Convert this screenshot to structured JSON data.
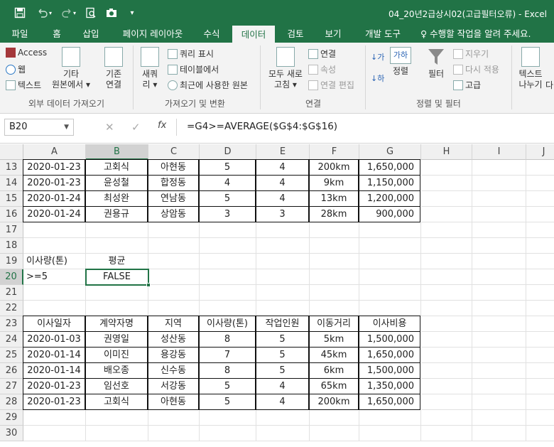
{
  "window": {
    "title": "04_20년2급상시02(고급필터오류) - Excel"
  },
  "quick_access": {
    "save_icon": "save-icon",
    "undo_icon": "undo-icon",
    "redo_icon": "redo-icon",
    "print_preview_icon": "print-preview-icon",
    "camera_icon": "camera-icon",
    "customize_label": "▾"
  },
  "ribbon_tabs": [
    "파일",
    "홈",
    "삽입",
    "페이지 레이아웃",
    "수식",
    "데이터",
    "검토",
    "보기",
    "개발 도구"
  ],
  "active_tab": "데이터",
  "tell_me": "♀ 수행할 작업을 알려 주세요.",
  "ribbon": {
    "get_external": {
      "access": "Access",
      "web": "웹",
      "text": "텍스트",
      "other_line1": "기타",
      "other_line2": "원본에서 ▾",
      "existing_line1": "기존",
      "existing_line2": "연결",
      "group_label": "외부 데이터 가져오기"
    },
    "get_transform": {
      "new_query_line1": "새쿼",
      "new_query_line2": "리 ▾",
      "show_queries": "쿼리 표시",
      "from_table": "테이블에서",
      "recent_sources": "최근에 사용한 원본",
      "group_label": "가져오기 및 변환"
    },
    "connections": {
      "refresh_line1": "모두 새로",
      "refresh_line2": "고침 ▾",
      "connections": "연결",
      "properties": "속성",
      "edit_links": "연결 편집",
      "group_label": "연결"
    },
    "sort_filter": {
      "sort_az": "↓가",
      "sort_za": "↓하",
      "sort_box": "가하",
      "sort": "정렬",
      "filter": "필터",
      "clear": "지우기",
      "reapply": "다시 적용",
      "advanced": "고급",
      "group_label": "정렬 및 필터"
    },
    "data_tools": {
      "text_to_columns_line1": "텍스트",
      "text_to_columns_line2": "나누기",
      "more": "다"
    }
  },
  "formula_bar": {
    "name_box": "B20",
    "cancel": "✕",
    "enter": "✓",
    "fx": "fx",
    "formula": "=G4>=AVERAGE($G$4:$G$16)"
  },
  "sheet": {
    "columns": [
      "A",
      "B",
      "C",
      "D",
      "E",
      "F",
      "G",
      "H",
      "I",
      "J"
    ],
    "selected_cell": "B20",
    "rows": [
      {
        "num": "13",
        "cells": [
          "2020-01-23",
          "고회식",
          "아현동",
          "5",
          "4",
          "200km",
          "1,650,000"
        ]
      },
      {
        "num": "14",
        "cells": [
          "2020-01-23",
          "윤성철",
          "합정동",
          "4",
          "4",
          "9km",
          "1,150,000"
        ]
      },
      {
        "num": "15",
        "cells": [
          "2020-01-24",
          "최성완",
          "연남동",
          "5",
          "4",
          "13km",
          "1,200,000"
        ]
      },
      {
        "num": "16",
        "cells": [
          "2020-01-24",
          "권용규",
          "상암동",
          "3",
          "3",
          "28km",
          "900,000"
        ]
      },
      {
        "num": "17",
        "cells": [
          "",
          "",
          "",
          "",
          "",
          "",
          ""
        ]
      },
      {
        "num": "18",
        "cells": [
          "",
          "",
          "",
          "",
          "",
          "",
          ""
        ]
      },
      {
        "num": "19",
        "cells": [
          "이사량(톤)",
          "평균",
          "",
          "",
          "",
          "",
          ""
        ]
      },
      {
        "num": "20",
        "cells": [
          ">=5",
          "FALSE",
          "",
          "",
          "",
          "",
          ""
        ]
      },
      {
        "num": "21",
        "cells": [
          "",
          "",
          "",
          "",
          "",
          "",
          ""
        ]
      },
      {
        "num": "22",
        "cells": [
          "",
          "",
          "",
          "",
          "",
          "",
          ""
        ]
      },
      {
        "num": "23",
        "cells": [
          "이사일자",
          "계약자명",
          "지역",
          "이사량(톤)",
          "작업인원",
          "이동거리",
          "이사비용"
        ]
      },
      {
        "num": "24",
        "cells": [
          "2020-01-03",
          "권영일",
          "성산동",
          "8",
          "5",
          "5km",
          "1,500,000"
        ]
      },
      {
        "num": "25",
        "cells": [
          "2020-01-14",
          "이미진",
          "용강동",
          "7",
          "5",
          "45km",
          "1,650,000"
        ]
      },
      {
        "num": "26",
        "cells": [
          "2020-01-14",
          "배오종",
          "신수동",
          "8",
          "5",
          "6km",
          "1,500,000"
        ]
      },
      {
        "num": "27",
        "cells": [
          "2020-01-23",
          "임선호",
          "서강동",
          "5",
          "4",
          "65km",
          "1,350,000"
        ]
      },
      {
        "num": "28",
        "cells": [
          "2020-01-23",
          "고회식",
          "아현동",
          "5",
          "4",
          "200km",
          "1,650,000"
        ]
      },
      {
        "num": "29",
        "cells": [
          "",
          "",
          "",
          "",
          "",
          "",
          ""
        ]
      },
      {
        "num": "30",
        "cells": [
          "",
          "",
          "",
          "",
          "",
          "",
          ""
        ]
      }
    ]
  },
  "colors": {
    "excel_green": "#217346",
    "ribbon_bg": "#f3f3f3",
    "header_bg": "#f0f0f0"
  }
}
